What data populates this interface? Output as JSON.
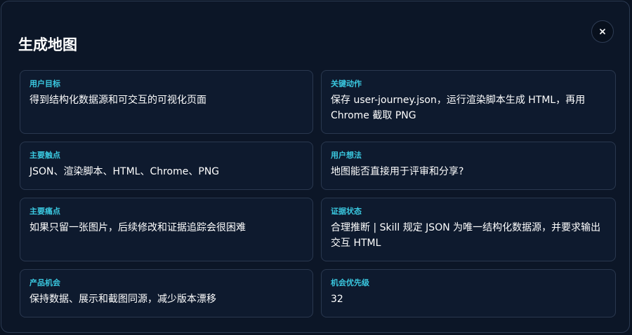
{
  "dialog": {
    "title": "生成地图",
    "close_label": "×"
  },
  "cards": [
    {
      "label": "用户目标",
      "value": "得到结构化数据源和可交互的可视化页面"
    },
    {
      "label": "关键动作",
      "value": "保存 user-journey.json，运行渲染脚本生成 HTML，再用 Chrome 截取 PNG"
    },
    {
      "label": "主要触点",
      "value": "JSON、渲染脚本、HTML、Chrome、PNG"
    },
    {
      "label": "用户想法",
      "value": "地图能否直接用于评审和分享?"
    },
    {
      "label": "主要痛点",
      "value": "如果只留一张图片，后续修改和证据追踪会很困难"
    },
    {
      "label": "证据状态",
      "value": "合理推断 | Skill 规定 JSON 为唯一结构化数据源，并要求输出交互 HTML"
    },
    {
      "label": "产品机会",
      "value": "保持数据、展示和截图同源，减少版本漂移"
    },
    {
      "label": "机会优先级",
      "value": "32"
    }
  ]
}
